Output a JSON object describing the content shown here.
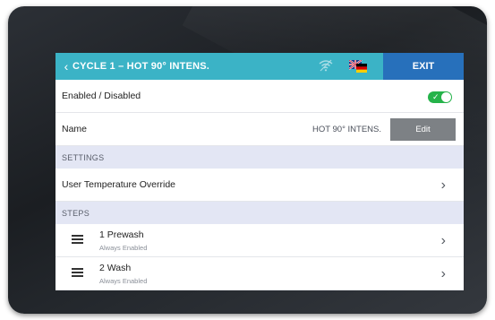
{
  "header": {
    "back_icon": "chevron-left-icon",
    "title": "CYCLE 1 – HOT 90° INTENS.",
    "wifi_icon": "wifi-icon",
    "language_flag_icon": "language-flag-icon",
    "exit_label": "EXIT",
    "colors": {
      "bar": "#3bb3c6",
      "exit": "#2770bb"
    }
  },
  "enabled": {
    "label": "Enabled / Disabled",
    "toggle_on": true,
    "toggle_color": "#25b34a"
  },
  "name": {
    "label": "Name",
    "value": "HOT 90° INTENS.",
    "edit_label": "Edit"
  },
  "settings": {
    "header": "SETTINGS",
    "items": [
      {
        "label": "User Temperature Override"
      }
    ]
  },
  "steps": {
    "header": "STEPS",
    "items": [
      {
        "title": "1 Prewash",
        "subtitle": "Always Enabled"
      },
      {
        "title": "2 Wash",
        "subtitle": "Always Enabled"
      }
    ]
  }
}
